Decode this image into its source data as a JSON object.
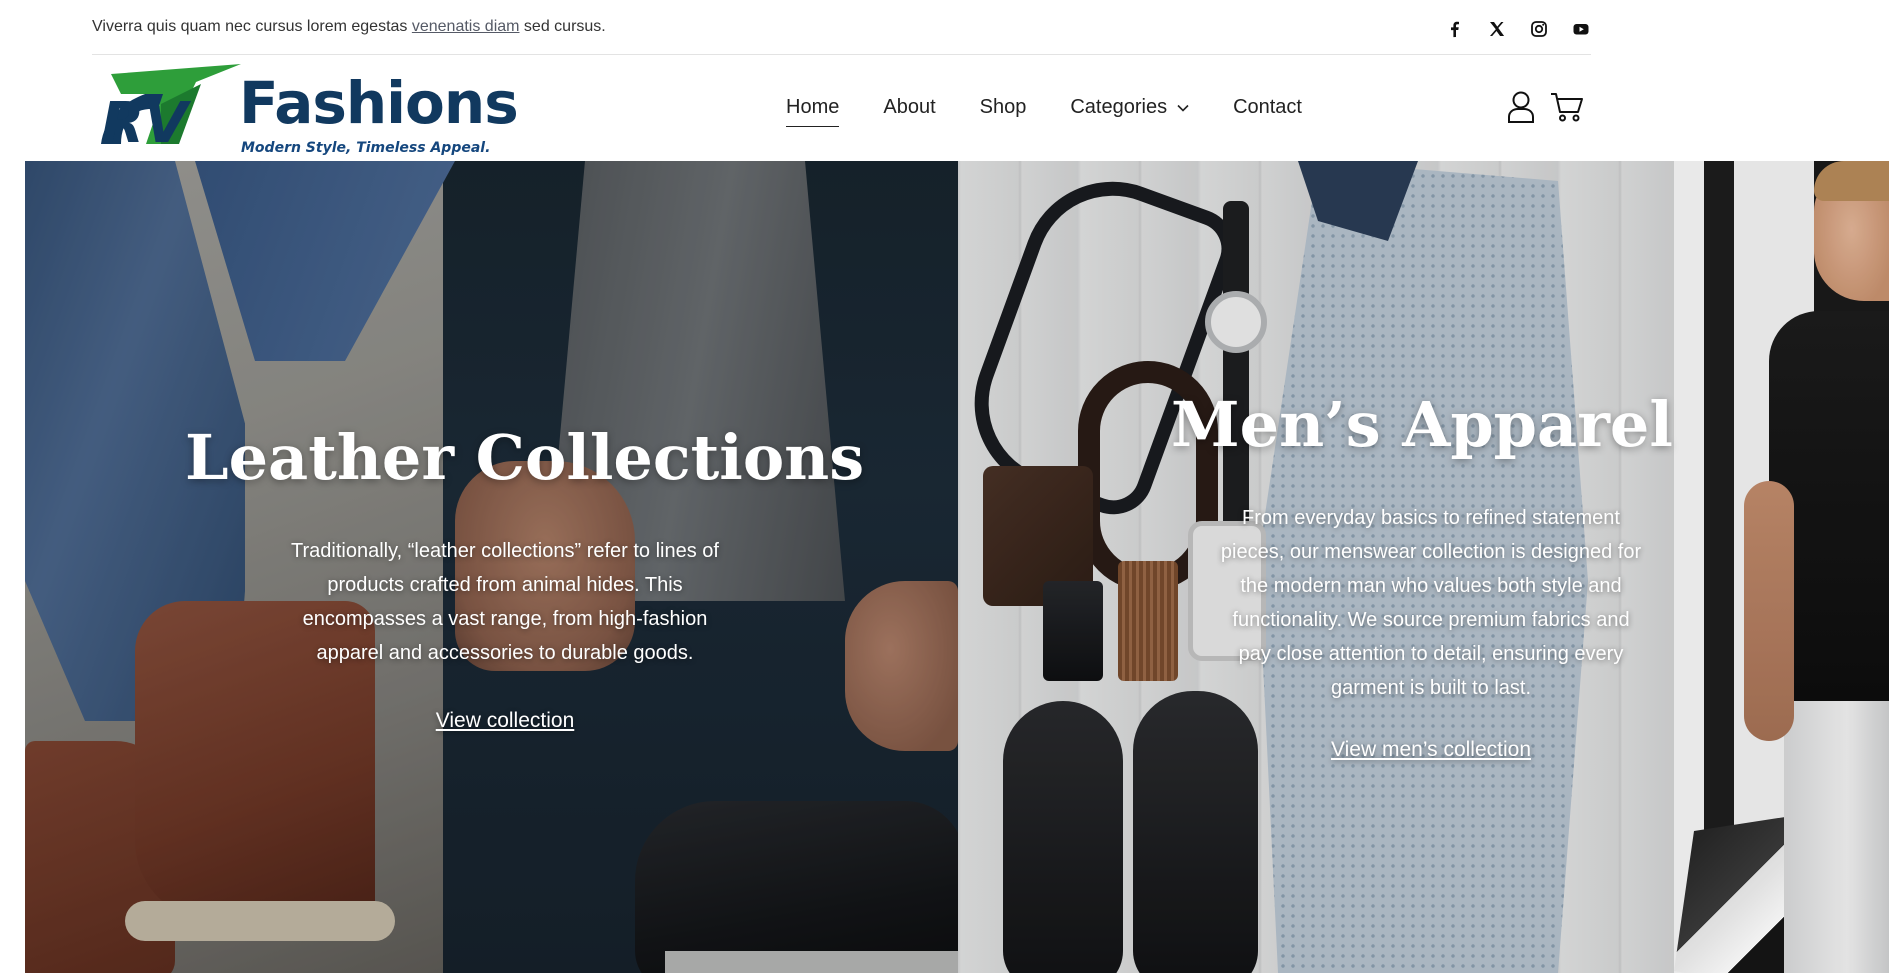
{
  "topbar": {
    "text_before": "Viverra quis quam nec cursus lorem egestas ",
    "link_text": "venenatis diam",
    "text_after": " sed cursus.",
    "socials": [
      "facebook-icon",
      "x-icon",
      "instagram-icon",
      "youtube-icon"
    ]
  },
  "logo": {
    "wordmark": "Fashions",
    "initials": "RV",
    "tagline": "Modern Style, Timeless Appeal.",
    "colors": {
      "green": "#2e9e3a",
      "navy": "#11395f"
    }
  },
  "nav": {
    "items": [
      {
        "label": "Home",
        "active": true
      },
      {
        "label": "About",
        "active": false
      },
      {
        "label": "Shop",
        "active": false
      },
      {
        "label": "Categories",
        "active": false,
        "has_dropdown": true
      },
      {
        "label": "Contact",
        "active": false
      }
    ]
  },
  "header_icons": [
    "user-icon",
    "cart-icon"
  ],
  "hero": {
    "left": {
      "title": "Leather Collections",
      "body": "Traditionally, “leather collections” refer to lines of products crafted from animal hides. This encompasses a vast range, from high-fashion apparel and accessories to durable goods.",
      "link": "View collection"
    },
    "middle": {
      "title": "Men’s Apparel",
      "body": "From everyday basics to refined statement pieces, our menswear collection is designed for the modern man who values both style and functionality. We source premium fabrics and pay close attention to detail, ensuring every garment is built to last.",
      "link": "View men’s collection"
    }
  }
}
